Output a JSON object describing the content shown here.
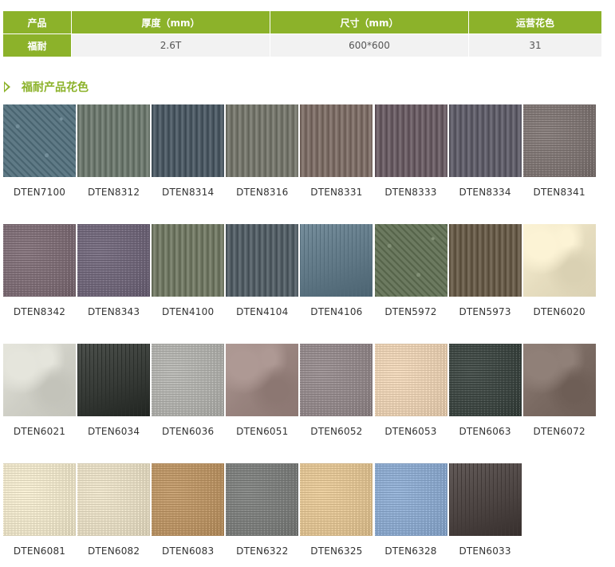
{
  "spec": {
    "headers": [
      "产品",
      "厚度（mm）",
      "尺寸（mm）",
      "运营花色"
    ],
    "row": {
      "product": "福耐",
      "thickness": "2.6T",
      "size": "600*600",
      "colors": "31"
    }
  },
  "section": {
    "title": "福耐产品花色"
  },
  "swatches": [
    [
      {
        "code": "DTEN7100",
        "color": "#5f7a86",
        "pattern": "speckle"
      },
      {
        "code": "DTEN8312",
        "color": "#6f7a70",
        "pattern": "stripe"
      },
      {
        "code": "DTEN8314",
        "color": "#4f5c66",
        "pattern": "stripe"
      },
      {
        "code": "DTEN8316",
        "color": "#77786e",
        "pattern": "stripe"
      },
      {
        "code": "DTEN8331",
        "color": "#7e6f68",
        "pattern": "stripe"
      },
      {
        "code": "DTEN8333",
        "color": "#6c5f66",
        "pattern": "stripe"
      },
      {
        "code": "DTEN8334",
        "color": "#62606b",
        "pattern": "stripe"
      },
      {
        "code": "DTEN8341",
        "color": "#7b7270",
        "pattern": "grain"
      }
    ],
    [
      {
        "code": "DTEN8342",
        "color": "#7a6a72",
        "pattern": "grain"
      },
      {
        "code": "DTEN8343",
        "color": "#6d6476",
        "pattern": "grain"
      },
      {
        "code": "DTEN4100",
        "color": "#737a66",
        "pattern": "stripe"
      },
      {
        "code": "DTEN4104",
        "color": "#566168",
        "pattern": "stripe"
      },
      {
        "code": "DTEN4106",
        "color": "#607886",
        "pattern": "plain"
      },
      {
        "code": "DTEN5972",
        "color": "#6c7a60",
        "pattern": "speckle"
      },
      {
        "code": "DTEN5973",
        "color": "#6a5e4c",
        "pattern": "stripe"
      },
      {
        "code": "DTEN6020",
        "color": "#e6ddbf",
        "pattern": "marble"
      }
    ],
    [
      {
        "code": "DTEN6021",
        "color": "#cfcfc6",
        "pattern": "marble"
      },
      {
        "code": "DTEN6034",
        "color": "#363a36",
        "pattern": "plain"
      },
      {
        "code": "DTEN6036",
        "color": "#aaaaa6",
        "pattern": "grain"
      },
      {
        "code": "DTEN6051",
        "color": "#98837e",
        "pattern": "marble"
      },
      {
        "code": "DTEN6052",
        "color": "#8e8486",
        "pattern": "grain"
      },
      {
        "code": "DTEN6053",
        "color": "#e0c8ac",
        "pattern": "grain"
      },
      {
        "code": "DTEN6063",
        "color": "#3d4642",
        "pattern": "grain"
      },
      {
        "code": "DTEN6072",
        "color": "#7a6a62",
        "pattern": "marble"
      }
    ],
    [
      {
        "code": "DTEN6081",
        "color": "#e4dcc2",
        "pattern": "grain"
      },
      {
        "code": "DTEN6082",
        "color": "#ddd4bc",
        "pattern": "grain"
      },
      {
        "code": "DTEN6083",
        "color": "#b48f62",
        "pattern": "grain"
      },
      {
        "code": "DTEN6322",
        "color": "#787a78",
        "pattern": "grain"
      },
      {
        "code": "DTEN6325",
        "color": "#d8bc8e",
        "pattern": "grain"
      },
      {
        "code": "DTEN6328",
        "color": "#87a3c6",
        "pattern": "grain"
      },
      {
        "code": "DTEN6033",
        "color": "#4c4442",
        "pattern": "plain"
      }
    ]
  ]
}
